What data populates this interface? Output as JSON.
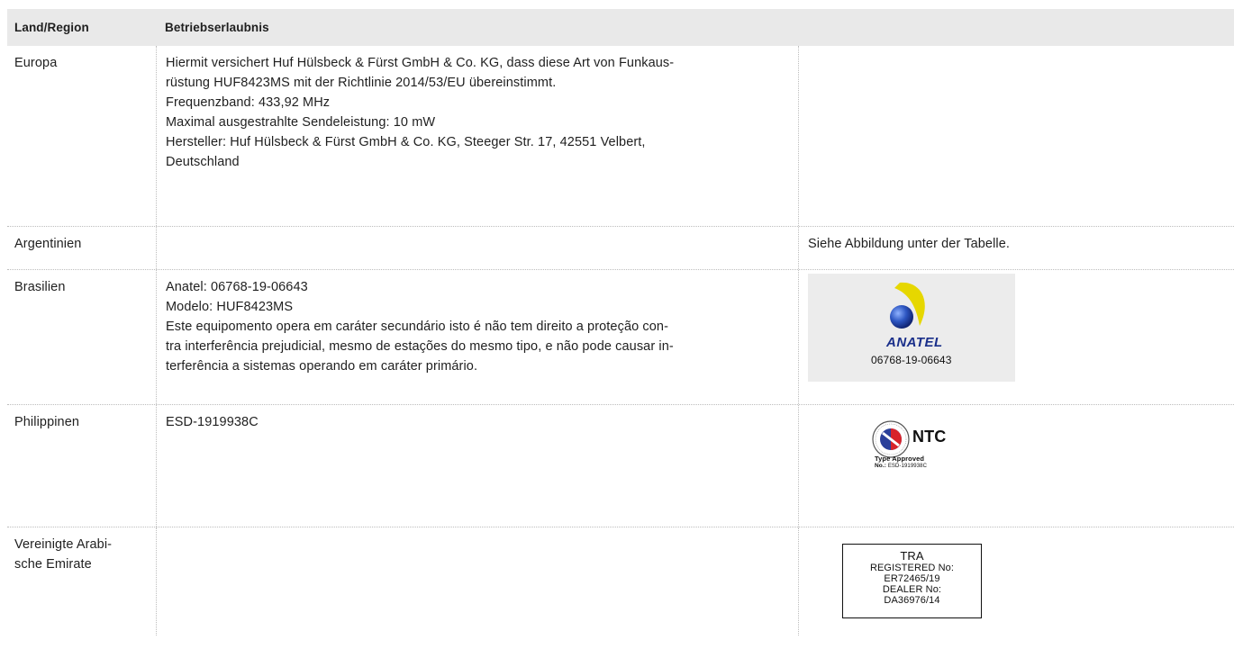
{
  "table": {
    "header": {
      "col1": "Land/Region",
      "col2": "Betriebserlaubnis"
    },
    "rows": {
      "europa": {
        "country": "Europa",
        "lines": [
          "Hiermit versichert Huf Hülsbeck & Fürst GmbH & Co. KG, dass diese Art von Funkaus-",
          "rüstung HUF8423MS mit der Richtlinie 2014/53/EU übereinstimmt.",
          "Frequenzband: 433,92 MHz",
          "Maximal ausgestrahlte Sendeleistung: 10 mW",
          "Hersteller: Huf Hülsbeck & Fürst GmbH & Co. KG, Steeger Str. 17, 42551 Velbert,",
          "Deutschland"
        ]
      },
      "argentinien": {
        "country": "Argentinien",
        "note": "Siehe Abbildung unter der Tabelle."
      },
      "brasilien": {
        "country": "Brasilien",
        "lines": [
          "Anatel: 06768-19-06643",
          "Modelo: HUF8423MS",
          "Este equipomento opera em caráter secundário isto é não tem direito a proteção con-",
          "tra interferência prejudicial, mesmo de estações do mesmo tipo, e não pode causar in-",
          "terferência a sistemas operando em caráter primário."
        ],
        "logo": {
          "word": "ANATEL",
          "number": "06768-19-06643",
          "colors": {
            "arc": "#e6d700",
            "sphere": "#1c3f9e",
            "background": "#ececec"
          }
        }
      },
      "philippinen": {
        "country": "Philippinen",
        "code": "ESD-1919938C",
        "logo": {
          "word": "NTC",
          "type_label": "Type Approved",
          "no_label": "No.:",
          "no_value": "ESD-1919938C",
          "colors": {
            "blue": "#2a3f9a",
            "red": "#d8232a"
          }
        }
      },
      "vae": {
        "country_line1": "Vereinigte Arabi-",
        "country_line2": "sche Emirate",
        "label": {
          "line1": "TRA",
          "line2": "REGISTERED No:",
          "line3": "ER72465/19",
          "line4": "DEALER No:",
          "line5": "DA36976/14"
        }
      }
    }
  }
}
